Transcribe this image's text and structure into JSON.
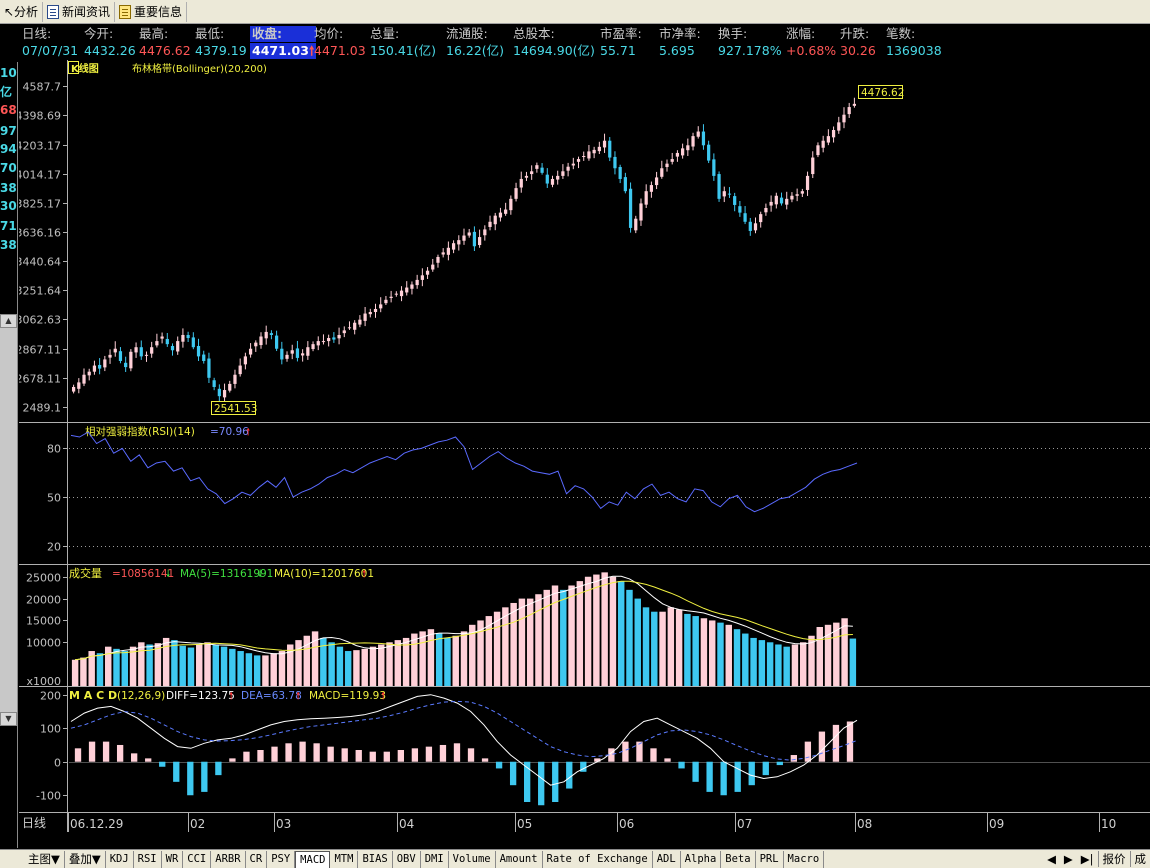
{
  "toolbar": {
    "items": [
      {
        "label": "分析",
        "icon": "arrow-cursor-icon"
      },
      {
        "label": "新闻资讯",
        "icon": "document-icon"
      },
      {
        "label": "重要信息",
        "icon": "clipboard-icon"
      }
    ]
  },
  "info": {
    "period_label": "日线:",
    "date": "07/07/31",
    "open_label": "今开:",
    "open": "4432.26",
    "high_label": "最高:",
    "high": "4476.62",
    "low_label": "最低:",
    "low": "4379.19",
    "close_label": "收盘:",
    "close": "4471.03",
    "avg_label": "均价:",
    "avg": "4471.03",
    "volume_label": "总量:",
    "volume": "150.41(亿)",
    "float_label": "流通股:",
    "float": "16.22(亿)",
    "total_label": "总股本:",
    "total": "14694.90(亿)",
    "pe_label": "市盈率:",
    "pe": "55.71",
    "pb_label": "市净率:",
    "pb": "5.695",
    "turnover_label": "换手:",
    "turnover": "927.178%",
    "change_pct_label": "涨幅:",
    "change_pct": "+0.68%",
    "change_label": "升跌:",
    "change": "30.26",
    "trades_label": "笔数:",
    "trades": "1369038"
  },
  "left_strip": [
    "10",
    "亿",
    "68",
    "97",
    "94",
    "70",
    "38",
    "30",
    "71",
    "38"
  ],
  "kline_panel": {
    "title": "K线图",
    "indicator": "布林格带(Bollinger)(20,200)",
    "y_ticks": [
      "4587.7",
      "4398.69",
      "4203.17",
      "4014.17",
      "3825.17",
      "3636.16",
      "3440.64",
      "3251.64",
      "3062.63",
      "2867.11",
      "2678.11",
      "2489.1"
    ],
    "high_marker": "4476.62",
    "low_marker": "2541.53"
  },
  "rsi_panel": {
    "title": "相对强弱指数(RSI)(14)",
    "value": "=70.96",
    "y_ticks": [
      "80",
      "50",
      "20"
    ]
  },
  "volume_panel": {
    "title": "成交量",
    "value": "=10856141",
    "ma5": "MA(5)=13161991",
    "ma10": "MA(10)=12017601",
    "y_ticks": [
      "25000",
      "20000",
      "15000",
      "10000",
      "x1000"
    ]
  },
  "macd_panel": {
    "title": "M A C D",
    "params": "(12,26,9)",
    "diff": "DIFF=123.75",
    "dea": "DEA=63.78",
    "macd": "MACD=119.93",
    "y_ticks": [
      "200",
      "100",
      "0",
      "-100"
    ]
  },
  "x_axis": {
    "period": "日线",
    "labels": [
      "06.12.29",
      "02",
      "03",
      "04",
      "05",
      "06",
      "07",
      "08",
      "09",
      "10"
    ]
  },
  "chart_data": [
    {
      "type": "candlestick",
      "title": "K线图",
      "ylim": [
        2489.1,
        4587.7
      ],
      "close": [
        2620,
        2650,
        2700,
        2720,
        2760,
        2740,
        2800,
        2830,
        2870,
        2790,
        2750,
        2850,
        2880,
        2820,
        2830,
        2880,
        2920,
        2950,
        2900,
        2860,
        2920,
        2960,
        2940,
        2880,
        2820,
        2790,
        2680,
        2620,
        2560,
        2600,
        2640,
        2700,
        2760,
        2820,
        2870,
        2910,
        2950,
        2980,
        2960,
        2870,
        2800,
        2830,
        2860,
        2810,
        2840,
        2880,
        2900,
        2920,
        2920,
        2940,
        2930,
        2960,
        2990,
        3010,
        3040,
        3060,
        3100,
        3110,
        3130,
        3160,
        3190,
        3210,
        3230,
        3250,
        3270,
        3290,
        3320,
        3350,
        3380,
        3420,
        3470,
        3500,
        3530,
        3560,
        3580,
        3610,
        3630,
        3540,
        3600,
        3650,
        3700,
        3740,
        3760,
        3780,
        3850,
        3920,
        3980,
        4000,
        4030,
        4070,
        4020,
        3950,
        3980,
        4000,
        4030,
        4060,
        4080,
        4110,
        4130,
        4160,
        4170,
        4190,
        4230,
        4120,
        4050,
        3980,
        3900,
        3660,
        3720,
        3820,
        3900,
        3940,
        3990,
        4050,
        4080,
        4110,
        4150,
        4180,
        4200,
        4260,
        4290,
        4200,
        4100,
        4000,
        3850,
        3900,
        3880,
        3810,
        3760,
        3700,
        3640,
        3690,
        3750,
        3790,
        3830,
        3870,
        3820,
        3850,
        3870,
        3880,
        3900,
        4000,
        4120,
        4200,
        4230,
        4260,
        4300,
        4350,
        4400,
        4450,
        4471.03
      ]
    },
    {
      "type": "line",
      "title": "相对强弱指数(RSI)(14)",
      "ylim": [
        10,
        95
      ],
      "series": [
        {
          "name": "RSI",
          "values": [
            88,
            87,
            90,
            83,
            86,
            77,
            80,
            72,
            76,
            68,
            71,
            72,
            66,
            68,
            60,
            62,
            55,
            52,
            46,
            49,
            53,
            51,
            56,
            60,
            56,
            62,
            50,
            53,
            55,
            58,
            62,
            64,
            67,
            65,
            68,
            71,
            73,
            75,
            73,
            77,
            79,
            80,
            82,
            84,
            85,
            87,
            81,
            67,
            71,
            75,
            78,
            74,
            71,
            69,
            66,
            65,
            64,
            66,
            52,
            57,
            55,
            50,
            43,
            47,
            45,
            53,
            49,
            55,
            58,
            51,
            53,
            49,
            47,
            55,
            54,
            47,
            44,
            49,
            51,
            44,
            41,
            43,
            46,
            49,
            50,
            53,
            56,
            61,
            64,
            66,
            67,
            69,
            70.96
          ]
        }
      ]
    },
    {
      "type": "bar",
      "title": "成交量",
      "ylabel": "x1000",
      "ylim": [
        0,
        27000
      ],
      "series": [
        {
          "name": "VOL",
          "values": [
            6000,
            6500,
            8000,
            7500,
            9000,
            8500,
            8000,
            9000,
            10000,
            9500,
            9800,
            11000,
            10500,
            9200,
            8800,
            9500,
            10000,
            9500,
            9000,
            8500,
            8000,
            7500,
            7000,
            7000,
            7500,
            8000,
            9500,
            10500,
            11500,
            12500,
            11000,
            10000,
            9000,
            8000,
            8200,
            8500,
            9000,
            9500,
            10000,
            10500,
            11000,
            12000,
            12500,
            13000,
            12000,
            11000,
            11500,
            12500,
            14000,
            15000,
            16000,
            17000,
            18000,
            19000,
            20000,
            20000,
            21000,
            22000,
            23000,
            22000,
            23000,
            24000,
            25000,
            25500,
            26000,
            25000,
            24000,
            22000,
            20000,
            18000,
            17000,
            17000,
            18000,
            17500,
            16500,
            16000,
            15500,
            15000,
            14500,
            14000,
            13000,
            12000,
            11000,
            10500,
            10000,
            9500,
            9000,
            9500,
            10000,
            11500,
            13500,
            14000,
            14500,
            15500,
            10856.141
          ]
        },
        {
          "name": "MA(5)",
          "values": [
            13161.991
          ]
        },
        {
          "name": "MA(10)",
          "values": [
            12017.601
          ]
        }
      ]
    },
    {
      "type": "line",
      "title": "M A C D",
      "ylim": [
        -150,
        220
      ],
      "series": [
        {
          "name": "DIFF",
          "values": [
            120,
            145,
            160,
            165,
            150,
            130,
            100,
            70,
            45,
            40,
            55,
            65,
            70,
            80,
            95,
            110,
            120,
            125,
            128,
            130,
            132,
            135,
            140,
            150,
            165,
            180,
            195,
            200,
            190,
            175,
            150,
            110,
            60,
            20,
            -10,
            -40,
            -70,
            -60,
            -30,
            -10,
            10,
            40,
            90,
            120,
            130,
            110,
            90,
            70,
            40,
            0,
            -20,
            -40,
            -50,
            -45,
            -30,
            -10,
            20,
            60,
            100,
            123.75
          ]
        },
        {
          "name": "DEA",
          "values": [
            100,
            110,
            125,
            140,
            150,
            145,
            130,
            110,
            90,
            75,
            65,
            62,
            63,
            66,
            72,
            80,
            90,
            98,
            105,
            110,
            115,
            120,
            125,
            130,
            138,
            148,
            160,
            170,
            178,
            180,
            178,
            165,
            145,
            120,
            95,
            70,
            45,
            30,
            20,
            15,
            18,
            25,
            40,
            60,
            80,
            92,
            95,
            90,
            80,
            65,
            48,
            32,
            18,
            8,
            5,
            10,
            20,
            35,
            48,
            63.78
          ]
        },
        {
          "name": "MACD",
          "values": [
            40,
            60,
            60,
            50,
            25,
            10,
            -15,
            -60,
            -100,
            -90,
            -40,
            10,
            30,
            35,
            45,
            55,
            60,
            55,
            45,
            40,
            35,
            30,
            30,
            35,
            40,
            45,
            50,
            55,
            40,
            10,
            -20,
            -70,
            -120,
            -130,
            -120,
            -80,
            -30,
            10,
            40,
            60,
            60,
            40,
            10,
            -20,
            -60,
            -90,
            -100,
            -90,
            -70,
            -40,
            -10,
            20,
            60,
            90,
            110,
            119.93
          ]
        }
      ]
    }
  ],
  "tabs": [
    "主图▼",
    "叠加▼",
    "KDJ",
    "RSI",
    "WR",
    "CCI",
    "ARBR",
    "CR",
    "PSY",
    "MACD",
    "MTM",
    "BIAS",
    "OBV",
    "DMI",
    "Volume",
    "Amount",
    "Rate of Exchange",
    "ADL",
    "Alpha",
    "Beta",
    "PRL",
    "Macro"
  ],
  "active_tab": "MACD",
  "tab_right": [
    "◀",
    "▶",
    "▶|",
    "报价",
    "成"
  ],
  "colors": {
    "up": "#ffd0d8",
    "down": "#3ec8f0",
    "rsi": "#5a6aff",
    "ma5": "#ffffff",
    "ma10": "#f0f040",
    "diff": "#ffffff",
    "dea": "#5a7aff",
    "grid": "#9a9a9a",
    "axis": "#b0b0b0",
    "highlight": "#1a2fd8"
  }
}
